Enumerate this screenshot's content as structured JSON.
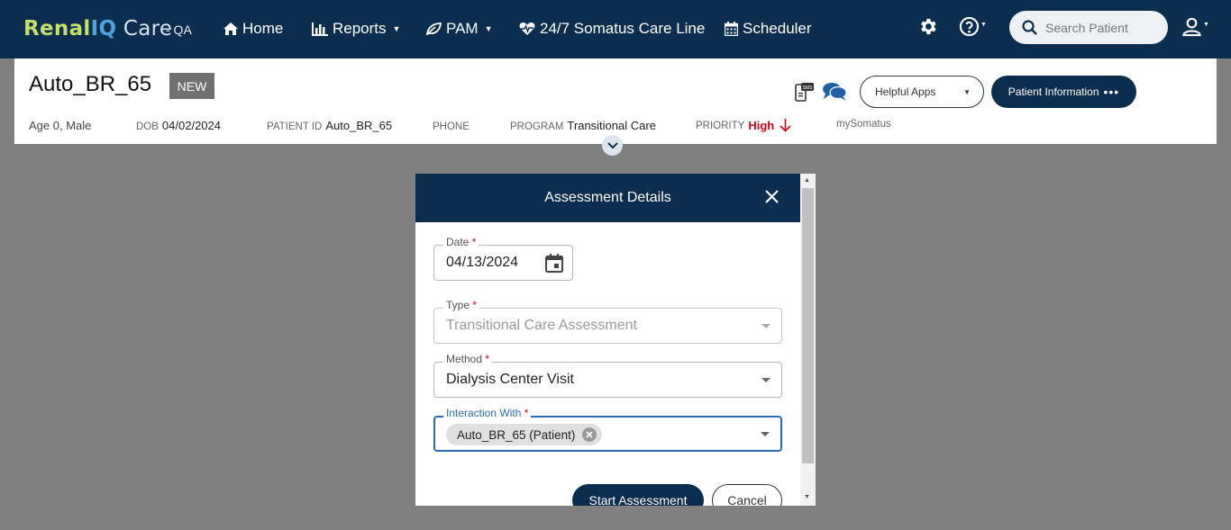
{
  "brand": {
    "part1": "Renal",
    "part2": "IQ",
    "part3": " Care",
    "env": "- QA"
  },
  "nav": {
    "home": "Home",
    "reports": "Reports",
    "pam": "PAM",
    "careline": "24/7 Somatus Care Line",
    "scheduler": "Scheduler"
  },
  "search": {
    "placeholder": "Search Patient"
  },
  "patient": {
    "name": "Auto_BR_65",
    "badge": "NEW",
    "age": "Age 0, Male",
    "dob_label": "DOB",
    "dob": "04/02/2024",
    "pid_label": "PATIENT ID",
    "pid": "Auto_BR_65",
    "phone_label": "PHONE",
    "phone": "",
    "program_label": "PROGRAM",
    "program": "Transitional Care",
    "priority_label": "PRIORITY",
    "priority": "High",
    "mysomatus": "mySomatus"
  },
  "header_buttons": {
    "helpful_apps": "Helpful Apps",
    "patient_info": "Patient Information"
  },
  "modal": {
    "title": "Assessment Details",
    "date": {
      "label": "Date",
      "value": "04/13/2024"
    },
    "type": {
      "label": "Type",
      "value": "Transitional Care Assessment"
    },
    "method": {
      "label": "Method",
      "value": "Dialysis Center Visit"
    },
    "interaction": {
      "label": "Interaction With",
      "chip": "Auto_BR_65 (Patient)"
    },
    "start_button": "Start Assessment",
    "cancel_button": "Cancel"
  },
  "colors": {
    "nav_bg": "#0b2e4f",
    "priority": "#d0021b",
    "accent": "#2b6cb0",
    "brand_green": "#c4de6a",
    "brand_blue": "#4fa3dc"
  }
}
